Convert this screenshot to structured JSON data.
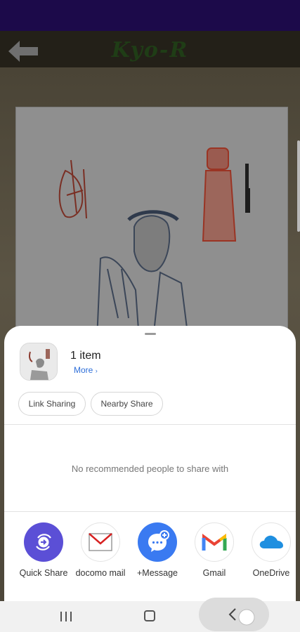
{
  "app": {
    "title": "Kyo-R"
  },
  "share_sheet": {
    "item_count": "1 item",
    "more_label": "More",
    "chips": {
      "link_sharing": "Link Sharing",
      "nearby_share": "Nearby Share"
    },
    "no_people_text": "No recommended people to share with",
    "apps": [
      {
        "label": "Quick Share",
        "icon": "quick-share-icon"
      },
      {
        "label": "docomo mail",
        "icon": "docomo-mail-icon"
      },
      {
        "label": "+Message",
        "icon": "plus-message-icon"
      },
      {
        "label": "Gmail",
        "icon": "gmail-icon"
      },
      {
        "label": "OneDrive",
        "icon": "onedrive-icon"
      }
    ]
  },
  "colors": {
    "status_bar": "#1c0a4a",
    "link_blue": "#2e6fd9",
    "quick_share": "#5b4fd6",
    "message_blue": "#3a7af1",
    "onedrive_blue": "#1f8fe0"
  }
}
